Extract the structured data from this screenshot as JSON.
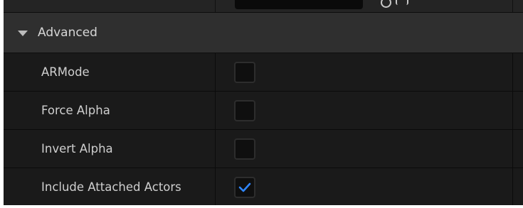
{
  "category": {
    "label": "Advanced"
  },
  "properties": [
    {
      "label": "ARMode",
      "checked": false
    },
    {
      "label": "Force Alpha",
      "checked": false
    },
    {
      "label": "Invert Alpha",
      "checked": false
    },
    {
      "label": "Include Attached Actors",
      "checked": true
    }
  ],
  "colors": {
    "checkmark": "#2f86ff",
    "panel_bg": "#151515",
    "category_bg": "#2f2f2f",
    "row_bg": "#1a1a1a",
    "text": "#cfcfcf"
  },
  "icons": {
    "category_toggle": "triangle-down-icon",
    "checkmark": "checkmark-icon"
  }
}
